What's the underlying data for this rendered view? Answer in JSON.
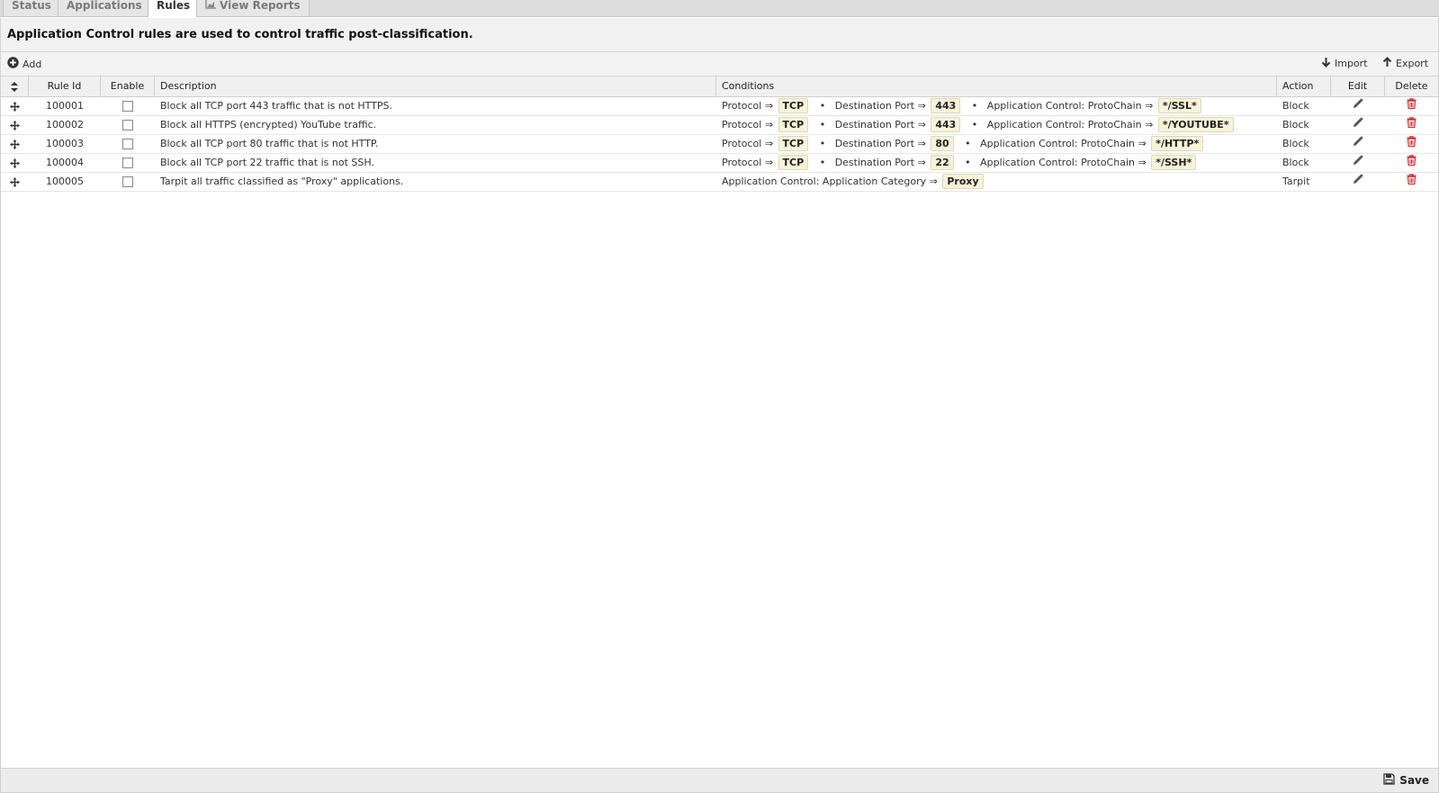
{
  "tabs": [
    {
      "label": "Status",
      "active": false
    },
    {
      "label": "Applications",
      "active": false
    },
    {
      "label": "Rules",
      "active": true
    },
    {
      "label": "View Reports",
      "active": false
    }
  ],
  "description": "Application Control rules are used to control traffic post-classification.",
  "toolbar": {
    "add_label": "Add",
    "import_label": "Import",
    "export_label": "Export"
  },
  "columns": {
    "rule_id": "Rule Id",
    "enable": "Enable",
    "description": "Description",
    "conditions": "Conditions",
    "action": "Action",
    "edit": "Edit",
    "delete": "Delete"
  },
  "condition_labels": {
    "protocol": "Protocol ⇒",
    "dest_port": "Destination Port ⇒",
    "protochain": "Application Control: ProtoChain ⇒",
    "category": "Application Control: Application Category ⇒",
    "bullet": "•"
  },
  "rules": [
    {
      "id": "100001",
      "enabled": false,
      "description": "Block all TCP port 443 traffic that is not HTTPS.",
      "protocol": "TCP",
      "port": "443",
      "protochain": "*/SSL*",
      "action": "Block"
    },
    {
      "id": "100002",
      "enabled": false,
      "description": "Block all HTTPS (encrypted) YouTube traffic.",
      "protocol": "TCP",
      "port": "443",
      "protochain": "*/YOUTUBE*",
      "action": "Block"
    },
    {
      "id": "100003",
      "enabled": false,
      "description": "Block all TCP port 80 traffic that is not HTTP.",
      "protocol": "TCP",
      "port": "80",
      "protochain": "*/HTTP*",
      "action": "Block"
    },
    {
      "id": "100004",
      "enabled": false,
      "description": "Block all TCP port 22 traffic that is not SSH.",
      "protocol": "TCP",
      "port": "22",
      "protochain": "*/SSH*",
      "action": "Block"
    },
    {
      "id": "100005",
      "enabled": false,
      "description": "Tarpit all traffic classified as \"Proxy\" applications.",
      "category": "Proxy",
      "action": "Tarpit"
    }
  ],
  "footer": {
    "save_label": "Save"
  },
  "colors": {
    "delete": "#d9232d",
    "tag_bg": "#f7f3d9"
  }
}
